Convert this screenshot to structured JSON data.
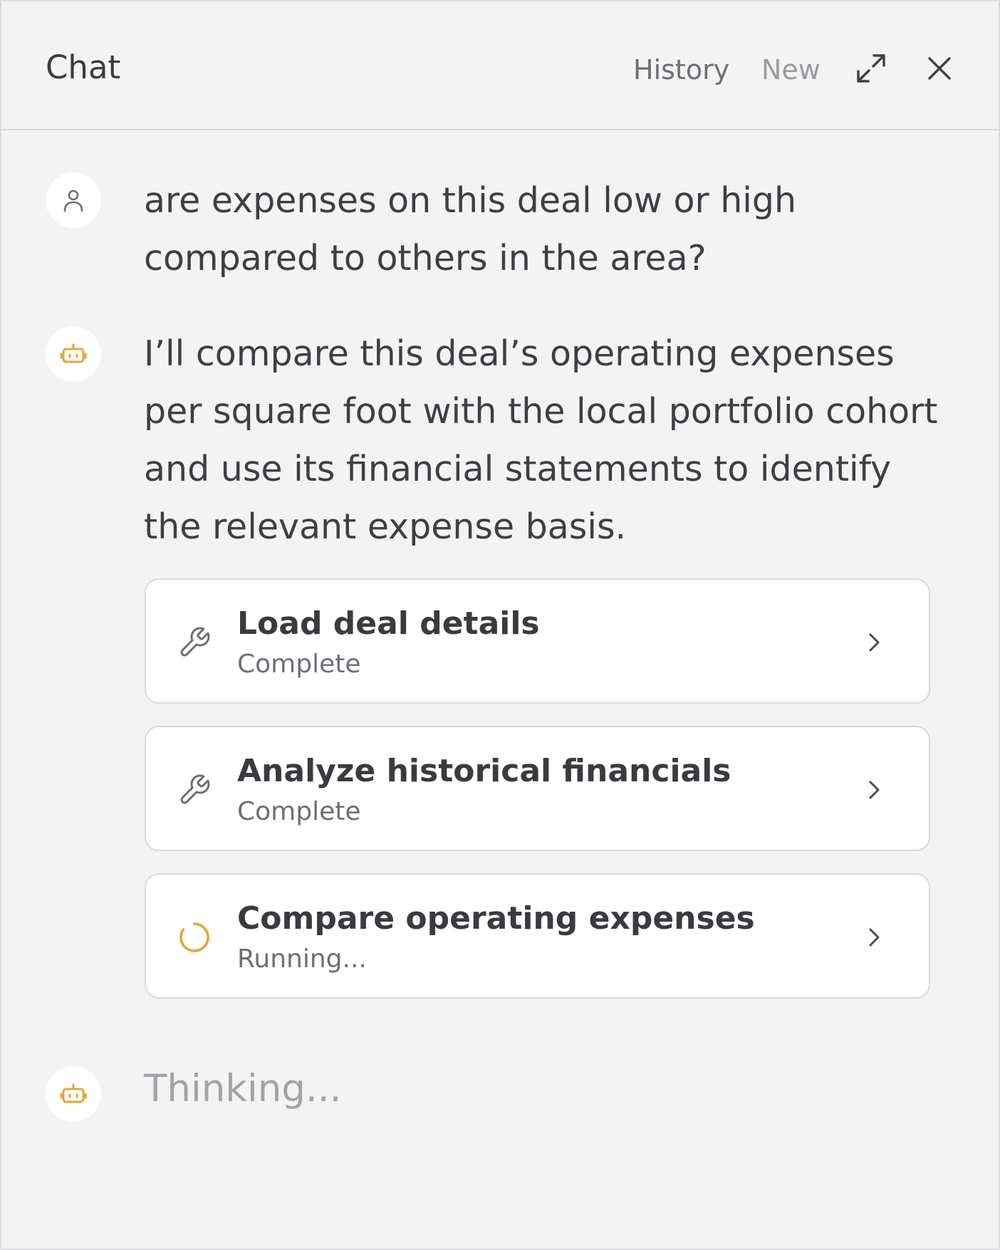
{
  "header": {
    "title": "Chat",
    "history_label": "History",
    "new_label": "New",
    "expand_icon": "expand-icon",
    "close_icon": "close-icon"
  },
  "messages": [
    {
      "role": "user",
      "avatar_icon": "user-icon",
      "text": "are expenses on this deal low or high compared to others in the area?"
    },
    {
      "role": "assistant",
      "avatar_icon": "robot-icon",
      "text": "I’ll compare this deal’s operating expenses per square foot with the local portfolio cohort and use its financial statements to identify the relevant expense basis."
    }
  ],
  "steps": [
    {
      "title": "Load deal details",
      "status": "Complete",
      "icon": "wrench-icon"
    },
    {
      "title": "Analyze historical financials",
      "status": "Complete",
      "icon": "wrench-icon"
    },
    {
      "title": "Compare operating expenses",
      "status": "Running...",
      "icon": "spinner-icon"
    }
  ],
  "thinking": {
    "avatar_icon": "robot-icon",
    "text": "Thinking..."
  },
  "colors": {
    "background": "#f3f3f3",
    "accent": "#e8a634",
    "text": "#3a3a3f",
    "muted": "#6e6e75"
  }
}
